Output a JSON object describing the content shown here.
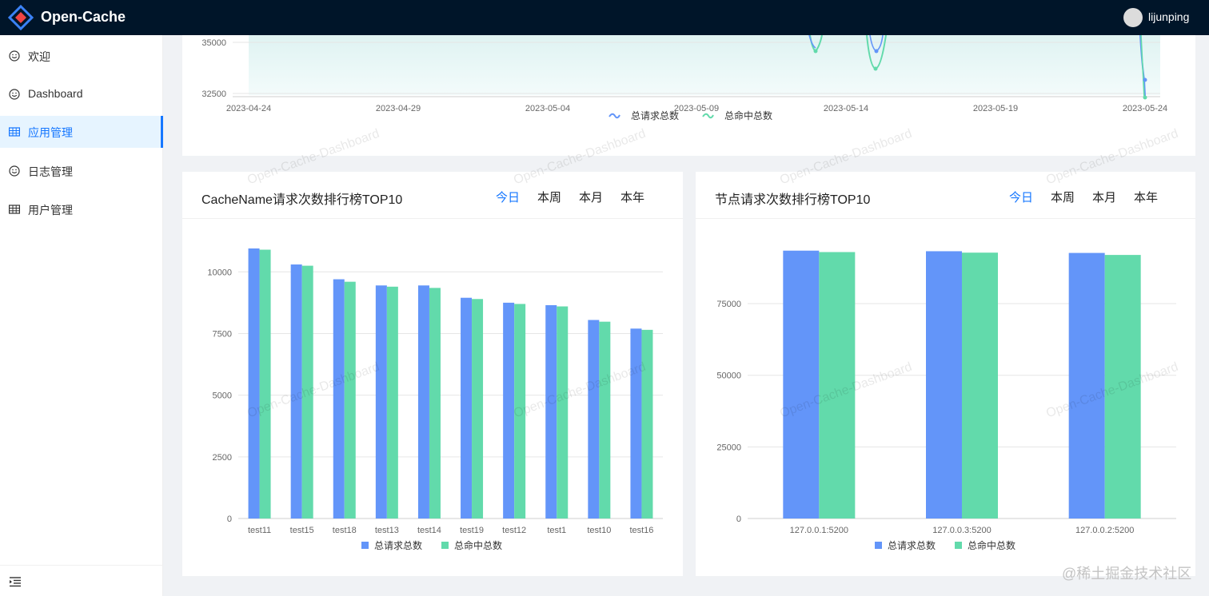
{
  "header": {
    "app_title": "Open-Cache",
    "user_name": "lijunping"
  },
  "sidebar": {
    "items": [
      {
        "label": "欢迎",
        "icon": "smile-icon"
      },
      {
        "label": "Dashboard",
        "icon": "smile-icon"
      },
      {
        "label": "应用管理",
        "icon": "table-icon",
        "active": true
      },
      {
        "label": "日志管理",
        "icon": "smile-icon"
      },
      {
        "label": "用户管理",
        "icon": "table-icon"
      }
    ],
    "collapse_icon": "menu-fold-icon"
  },
  "watermark": "Open-Cache-Dashboard",
  "corner_credit": "@稀土掘金技术社区",
  "colors": {
    "header_bg": "#001529",
    "accent": "#1677ff",
    "series_request": "#6395f9",
    "series_hit": "#62daab"
  },
  "ranking_left": {
    "title": "CacheName请求次数排行榜TOP10",
    "tabs": [
      "今日",
      "本周",
      "本月",
      "本年"
    ],
    "active_tab": "今日"
  },
  "ranking_right": {
    "title": "节点请求次数排行榜TOP10",
    "tabs": [
      "今日",
      "本周",
      "本月",
      "本年"
    ],
    "active_tab": "今日"
  },
  "chart_data": [
    {
      "type": "area",
      "x_ticks": [
        "2023-04-24",
        "2023-04-29",
        "2023-05-04",
        "2023-05-09",
        "2023-05-14",
        "2023-05-19",
        "2023-05-24"
      ],
      "y_ticks": [
        32500,
        35000
      ],
      "series": [
        {
          "name": "总请求总数"
        },
        {
          "name": "总命中总数"
        }
      ],
      "legend": "bottom"
    },
    {
      "type": "bar",
      "categories": [
        "test11",
        "test15",
        "test18",
        "test13",
        "test14",
        "test19",
        "test12",
        "test1",
        "test10",
        "test16"
      ],
      "series": [
        {
          "name": "总请求总数",
          "values": [
            10950,
            10300,
            9700,
            9450,
            9450,
            8950,
            8750,
            8650,
            8050,
            7700
          ]
        },
        {
          "name": "总命中总数",
          "values": [
            10900,
            10250,
            9600,
            9400,
            9350,
            8900,
            8700,
            8600,
            7980,
            7650
          ]
        }
      ],
      "y_ticks": [
        0,
        2500,
        5000,
        7500,
        10000
      ],
      "ylim": [
        0,
        11500
      ],
      "legend": "bottom"
    },
    {
      "type": "bar",
      "categories": [
        "127.0.0.1:5200",
        "127.0.0.3:5200",
        "127.0.0.2:5200"
      ],
      "series": [
        {
          "name": "总请求总数",
          "values": [
            93500,
            93300,
            92700
          ]
        },
        {
          "name": "总命中总数",
          "values": [
            93000,
            92800,
            92000
          ]
        }
      ],
      "y_ticks": [
        0,
        25000,
        50000,
        75000
      ],
      "ylim": [
        0,
        99000
      ],
      "legend": "bottom"
    }
  ]
}
